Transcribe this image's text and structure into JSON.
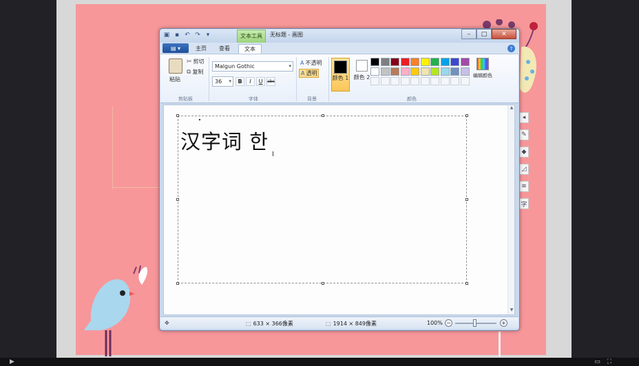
{
  "titlebar": {
    "context_tab": "文本工具",
    "title": "无标题 - 画图",
    "minimize": "–",
    "maximize": "□",
    "close": "✕"
  },
  "tabs": {
    "file": "▤ ▾",
    "home": "主页",
    "view": "查看",
    "text": "文本",
    "help": "?"
  },
  "clipboard": {
    "paste": "粘贴",
    "cut": "剪切",
    "copy": "复制",
    "group": "剪贴板"
  },
  "font": {
    "family": "Malgun Gothic",
    "size": "36",
    "bold": "B",
    "italic": "I",
    "underline": "U",
    "strike": "abc",
    "group": "字体"
  },
  "background": {
    "opaque": "不透明",
    "transparent": "透明",
    "group": "背景"
  },
  "colors": {
    "color1": "颜色 1",
    "color2": "颜色 2",
    "edit": "编辑颜色",
    "group": "颜色",
    "palette": [
      "#000000",
      "#7f7f7f",
      "#880015",
      "#ed1c24",
      "#ff7f27",
      "#fff200",
      "#22b14c",
      "#00a2e8",
      "#3f48cc",
      "#a349a4",
      "#ffffff",
      "#c3c3c3",
      "#b97a57",
      "#ffaec9",
      "#ffc90e",
      "#efe4b0",
      "#b5e61d",
      "#99d9ea",
      "#7092be",
      "#c8bfe7",
      "",
      "",
      "",
      "",
      "",
      "",
      "",
      "",
      "",
      ""
    ]
  },
  "canvas": {
    "text": "汉字词 한",
    "cursor": "I"
  },
  "status": {
    "selection_size": "633 × 366像素",
    "image_size": "1914 × 849像素",
    "zoom": "100%",
    "zoom_out": "−",
    "zoom_in": "+"
  }
}
